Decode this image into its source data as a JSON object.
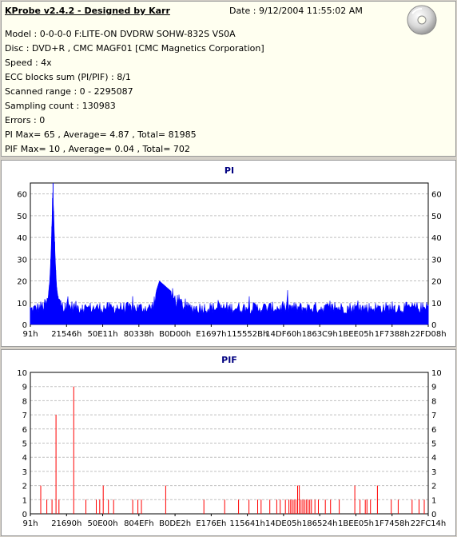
{
  "header": {
    "title": "KProbe v2.4.2 - Designed by Karr",
    "date": "Date : 9/12/2004 11:55:02 AM"
  },
  "info_lines": [
    "Model : 0-0-0-0 F:LITE-ON DVDRW SOHW-832S  VS0A",
    "Disc : DVD+R , CMC MAGF01 [CMC Magnetics Corporation]",
    "Speed : 4x",
    "ECC blocks sum (PI/PIF) : 8/1",
    "Scanned range : 0 - 2295087",
    "Sampling count : 130983",
    "Errors : 0",
    "PI Max= 65 , Average= 4.87 , Total= 81985",
    "PIF Max= 10 , Average= 0.04 , Total= 702"
  ],
  "colors": {
    "pi_series": "#0000ff",
    "pif_series": "#ff0000",
    "title": "#000080",
    "grid": "#c0c0c0"
  },
  "icons": {
    "logo": "disc-icon"
  },
  "chart_data": [
    {
      "type": "area",
      "title": "PI",
      "ylim": [
        0,
        65
      ],
      "yticks": [
        0,
        10,
        20,
        30,
        40,
        50,
        60
      ],
      "grid": true,
      "xlim": [
        145,
        2293000
      ],
      "tick_labels": [
        "91h",
        "21546h",
        "50E11h",
        "80338h",
        "B0D00h",
        "E1697h",
        "115552Bh",
        "14DF60h",
        "1863C9h",
        "1BEE05h",
        "1F7388h",
        "22FD08h"
      ],
      "series": [
        {
          "values": [
            [
              0,
              8
            ],
            [
              40000,
              9
            ],
            [
              80000,
              10
            ],
            [
              100000,
              12
            ],
            [
              110000,
              18
            ],
            [
              118000,
              30
            ],
            [
              124000,
              45
            ],
            [
              128000,
              58
            ],
            [
              131000,
              65
            ],
            [
              134000,
              52
            ],
            [
              140000,
              38
            ],
            [
              146000,
              25
            ],
            [
              152000,
              17
            ],
            [
              160000,
              13
            ],
            [
              175000,
              11
            ],
            [
              200000,
              10
            ],
            [
              300000,
              9
            ],
            [
              500000,
              9
            ],
            [
              700000,
              9
            ],
            [
              744000,
              20
            ],
            [
              900000,
              9
            ],
            [
              1100000,
              9
            ],
            [
              1300000,
              9
            ],
            [
              1500000,
              9
            ],
            [
              1700000,
              9
            ],
            [
              1900000,
              9
            ],
            [
              2100000,
              9
            ],
            [
              2293000,
              9
            ]
          ]
        }
      ]
    },
    {
      "type": "bar",
      "title": "PIF",
      "ylim": [
        0,
        10
      ],
      "yticks": [
        0,
        1,
        2,
        3,
        4,
        5,
        6,
        7,
        8,
        9,
        10
      ],
      "grid": true,
      "xlim": [
        145,
        2293000
      ],
      "tick_labels": [
        "91h",
        "21690h",
        "50E00h",
        "804EFh",
        "B0DE2h",
        "E176Eh",
        "115641h",
        "14DE05h",
        "186524h",
        "1BEE05h",
        "1F7458h",
        "22FC14h"
      ],
      "series": [
        {
          "values": [
            [
              60000,
              2
            ],
            [
              95000,
              1
            ],
            [
              125000,
              1
            ],
            [
              148000,
              7
            ],
            [
              165000,
              1
            ],
            [
              250000,
              9
            ],
            [
              320000,
              1
            ],
            [
              380000,
              1
            ],
            [
              400000,
              1
            ],
            [
              420000,
              2
            ],
            [
              450000,
              1
            ],
            [
              480000,
              1
            ],
            [
              590000,
              1
            ],
            [
              620000,
              1
            ],
            [
              640000,
              1
            ],
            [
              780000,
              2
            ],
            [
              1000000,
              1
            ],
            [
              1120000,
              1
            ],
            [
              1200000,
              1
            ],
            [
              1260000,
              1
            ],
            [
              1310000,
              1
            ],
            [
              1330000,
              1
            ],
            [
              1380000,
              1
            ],
            [
              1420000,
              1
            ],
            [
              1440000,
              1
            ],
            [
              1470000,
              1
            ],
            [
              1490000,
              1
            ],
            [
              1500000,
              1
            ],
            [
              1510000,
              1
            ],
            [
              1520000,
              1
            ],
            [
              1530000,
              1
            ],
            [
              1540000,
              2
            ],
            [
              1550000,
              2
            ],
            [
              1560000,
              1
            ],
            [
              1570000,
              1
            ],
            [
              1580000,
              1
            ],
            [
              1590000,
              1
            ],
            [
              1600000,
              1
            ],
            [
              1610000,
              1
            ],
            [
              1620000,
              1
            ],
            [
              1640000,
              1
            ],
            [
              1660000,
              1
            ],
            [
              1700000,
              1
            ],
            [
              1730000,
              1
            ],
            [
              1780000,
              1
            ],
            [
              1870000,
              2
            ],
            [
              1900000,
              1
            ],
            [
              1930000,
              1
            ],
            [
              1940000,
              1
            ],
            [
              1960000,
              1
            ],
            [
              2000000,
              2
            ],
            [
              2080000,
              1
            ],
            [
              2120000,
              1
            ],
            [
              2200000,
              1
            ],
            [
              2240000,
              1
            ],
            [
              2270000,
              1
            ]
          ]
        }
      ]
    }
  ]
}
